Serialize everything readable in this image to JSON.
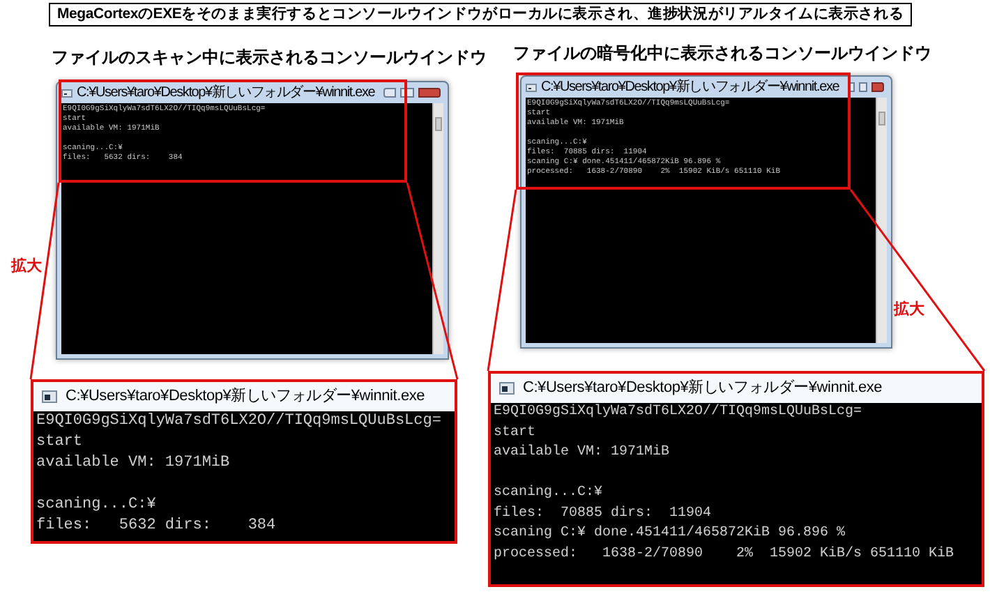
{
  "caption": "MegaCortexのEXEをそのまま実行するとコンソールウインドウがローカルに表示され、進捗状況がリアルタイムに表示される",
  "panels": [
    {
      "heading": "ファイルのスキャン中に表示されるコンソールウインドウ",
      "window": {
        "title": "C:¥Users¥taro¥Desktop¥新しいフォルダー¥winnit.exe",
        "blocks": [
          [
            "E9QI0G9gSiXqlyWa7sdT6LX2O//TIQq9msLQUuBsLcg=",
            "start",
            "available VM: 1971MiB"
          ],
          [
            "scaning...C:¥",
            "files:   5632 dirs:    384"
          ]
        ]
      },
      "zoom_label": "拡大",
      "zoomed_window": {
        "title": "C:¥Users¥taro¥Desktop¥新しいフォルダー¥winnit.exe",
        "blocks": [
          [
            "E9QI0G9gSiXqlyWa7sdT6LX2O//TIQq9msLQUuBsLcg=",
            "start",
            "available VM: 1971MiB"
          ],
          [
            "scaning...C:¥",
            "files:   5632 dirs:    384"
          ]
        ]
      }
    },
    {
      "heading": "ファイルの暗号化中に表示されるコンソールウインドウ",
      "window": {
        "title": "C:¥Users¥taro¥Desktop¥新しいフォルダー¥winnit.exe",
        "blocks": [
          [
            "E9QI0G9gSiXqlyWa7sdT6LX2O//TIQq9msLQUuBsLcg=",
            "start",
            "available VM: 1971MiB"
          ],
          [
            "scaning...C:¥",
            "files:  70885 dirs:  11904",
            "scaning C:¥ done.451411/465872KiB 96.896 %",
            "processed:   1638-2/70890    2%  15902 KiB/s 651110 KiB"
          ]
        ]
      },
      "zoom_label": "拡大",
      "zoomed_window": {
        "title": "C:¥Users¥taro¥Desktop¥新しいフォルダー¥winnit.exe",
        "blocks": [
          [
            "E9QI0G9gSiXqlyWa7sdT6LX2O//TIQq9msLQUuBsLcg=",
            "start",
            "available VM: 1971MiB"
          ],
          [
            "scaning...C:¥",
            "files:  70885 dirs:  11904",
            "scaning C:¥ done.451411/465872KiB 96.896 %",
            "processed:   1638-2/70890    2%  15902 KiB/s 651110 KiB"
          ]
        ]
      }
    }
  ]
}
